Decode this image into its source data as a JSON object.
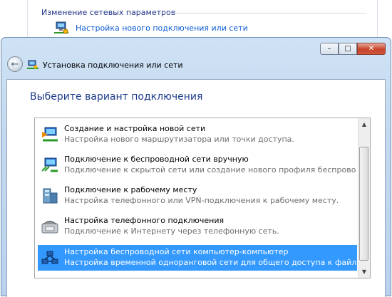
{
  "background_panel": {
    "heading": "Изменение сетевых параметров",
    "link": "Настройка нового подключения или сети"
  },
  "window": {
    "title": "Установка подключения или сети",
    "controls": {
      "minimize": "–",
      "maximize": "□",
      "close": "✕"
    },
    "back_arrow": "←"
  },
  "main": {
    "heading": "Выберите вариант подключения",
    "options": [
      {
        "title": "Создание и настройка новой сети",
        "desc": "Настройка нового маршрутизатора или точки доступа.",
        "icon": "new-network-icon",
        "selected": false
      },
      {
        "title": "Подключение к беспроводной сети вручную",
        "desc": "Подключение к скрытой сети или создание нового профиля беспроводной связи.",
        "icon": "wireless-network-icon",
        "selected": false
      },
      {
        "title": "Подключение к рабочему месту",
        "desc": "Настройка телефонного или VPN-подключения к рабочему месту.",
        "icon": "workplace-icon",
        "selected": false
      },
      {
        "title": "Настройка телефонного подключения",
        "desc": "Подключение к Интернету через телефонную сеть.",
        "icon": "dialup-phone-icon",
        "selected": false
      },
      {
        "title": "Настройка беспроводной сети компьютер-компьютер",
        "desc": "Настройка временной одноранговой сети для общего доступа к файлам или к Инт...",
        "icon": "adhoc-network-icon",
        "selected": true
      }
    ],
    "scrollbar": {
      "up": "▲",
      "down": "▼"
    }
  },
  "colors": {
    "selection": "#3399ff",
    "heading": "#1e3c8c",
    "link": "#0b5bd3"
  }
}
